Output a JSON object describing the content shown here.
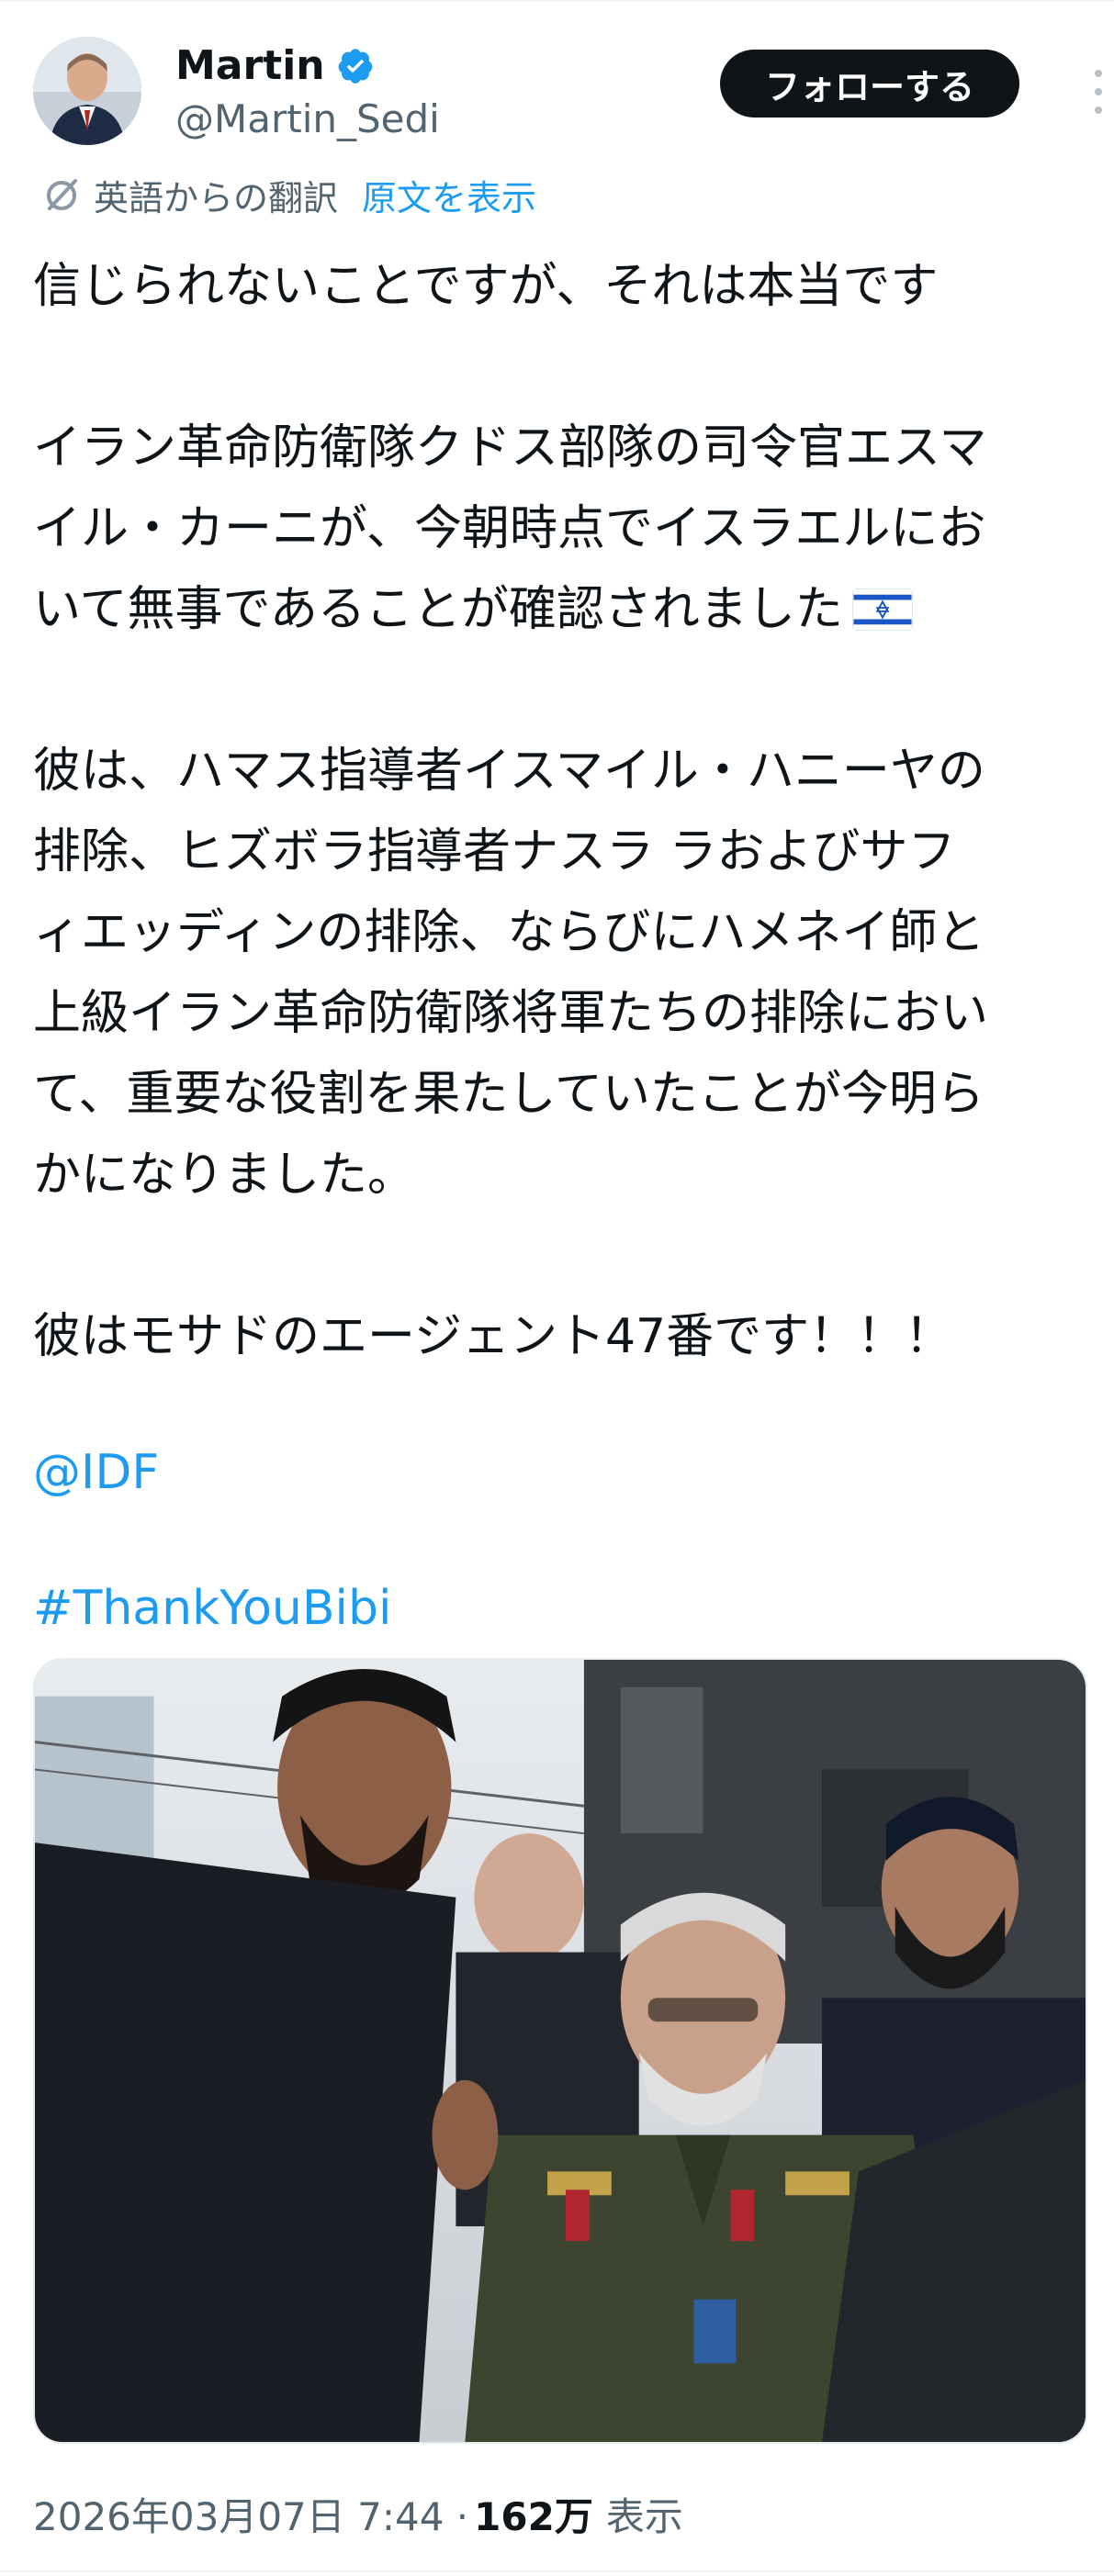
{
  "author": {
    "display_name": "Martin",
    "handle": "@Martin_Sedi",
    "verified": true
  },
  "actions": {
    "follow_label": "フォローする"
  },
  "translation": {
    "label": "英語からの翻訳",
    "show_original": "原文を表示"
  },
  "tweet": {
    "line1": "信じられないことですが、それは本当です",
    "p2_line1": "イラン革命防衛隊クドス部隊の司令官エスマ",
    "p2_line2": "イル・カーニが、今朝時点でイスラエルにお",
    "p2_line3": "いて無事であることが確認されました",
    "p3_line1": "彼は、ハマス指導者イスマイル・ハニーヤの",
    "p3_line2": "排除、ヒズボラ指導者ナスラ ラおよびサフ",
    "p3_line3": "ィエッディンの排除、ならびにハメネイ師と",
    "p3_line4": "上級イラン革命防衛隊将軍たちの排除におい",
    "p3_line5": "て、重要な役割を果たしていたことが今明ら",
    "p3_line6": "かになりました。",
    "p4": "彼はモサドのエージェント47番です！！！",
    "mention": "@IDF",
    "hashtag": "#ThankYouBibi"
  },
  "meta": {
    "timestamp": "2026年03月07日 7:44 · ",
    "views_count": "162万",
    "views_label": "表示"
  },
  "colors": {
    "accent": "#1d9bf0",
    "text": "#0f1419",
    "secondary": "#536471"
  }
}
